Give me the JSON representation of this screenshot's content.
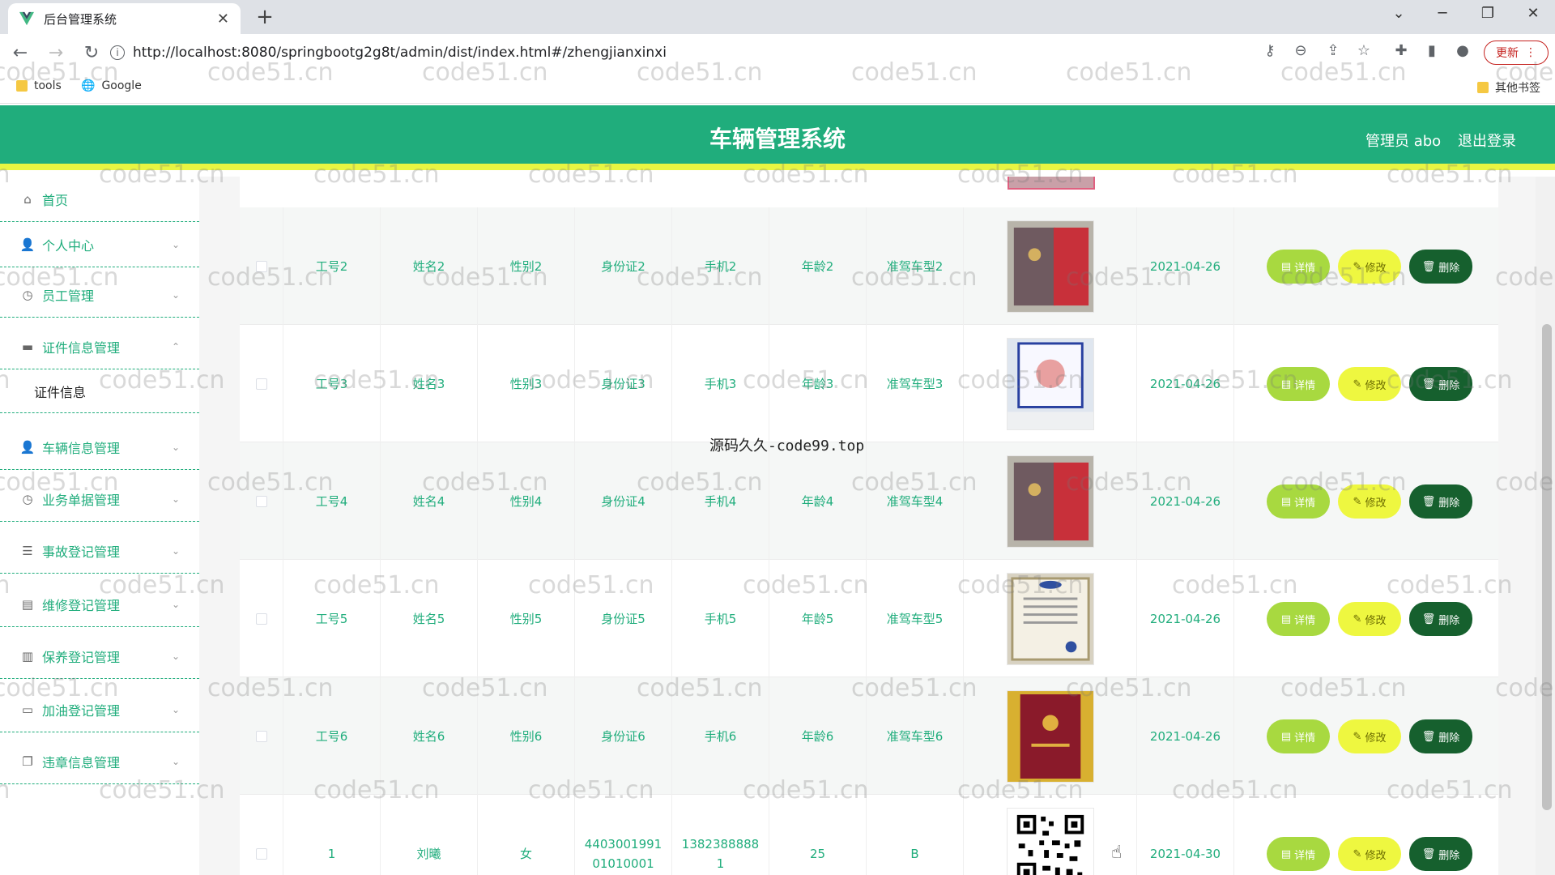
{
  "browser": {
    "tab_title": "后台管理系统",
    "tab_close": "✕",
    "new_tab": "+",
    "url": "http://localhost:8080/springbootg2g8t/admin/dist/index.html#/zhengjianxinxi",
    "update_label": "更新",
    "bookmarks": [
      {
        "label": "tools"
      },
      {
        "label": "Google"
      }
    ],
    "other_bookmarks": "其他书签"
  },
  "app": {
    "title": "车辆管理系统",
    "user": "管理员 abo",
    "logout": "退出登录"
  },
  "sidebar": {
    "items": [
      {
        "label": "首页",
        "icon": "home-icon"
      },
      {
        "label": "个人中心",
        "icon": "user-icon"
      },
      {
        "label": "员工管理",
        "icon": "clock-icon"
      },
      {
        "label": "证件信息管理",
        "icon": "card-icon"
      },
      {
        "label": "车辆信息管理",
        "icon": "user-icon"
      },
      {
        "label": "业务单据管理",
        "icon": "clock-icon"
      },
      {
        "label": "事故登记管理",
        "icon": "sliders-icon"
      },
      {
        "label": "维修登记管理",
        "icon": "printer-icon"
      },
      {
        "label": "保养登记管理",
        "icon": "chart-icon"
      },
      {
        "label": "加油登记管理",
        "icon": "chat-icon"
      },
      {
        "label": "违章信息管理",
        "icon": "copy-icon"
      }
    ],
    "submenu": "证件信息"
  },
  "table": {
    "rows": [
      {
        "no": "工号2",
        "name": "姓名2",
        "gender": "性别2",
        "id": "身份证2",
        "phone": "手机2",
        "age": "年龄2",
        "license": "准驾车型2",
        "img": "book",
        "date": "2021-04-26"
      },
      {
        "no": "工号3",
        "name": "姓名3",
        "gender": "性别3",
        "id": "身份证3",
        "phone": "手机3",
        "age": "年龄3",
        "license": "准驾车型3",
        "img": "cert",
        "date": "2021-04-26"
      },
      {
        "no": "工号4",
        "name": "姓名4",
        "gender": "性别4",
        "id": "身份证4",
        "phone": "手机4",
        "age": "年龄4",
        "license": "准驾车型4",
        "img": "book",
        "date": "2021-04-26"
      },
      {
        "no": "工号5",
        "name": "姓名5",
        "gender": "性别5",
        "id": "身份证5",
        "phone": "手机5",
        "age": "年龄5",
        "license": "准驾车型5",
        "img": "diploma",
        "date": "2021-04-26"
      },
      {
        "no": "工号6",
        "name": "姓名6",
        "gender": "性别6",
        "id": "身份证6",
        "phone": "手机6",
        "age": "年龄6",
        "license": "准驾车型6",
        "img": "redbook",
        "date": "2021-04-26"
      },
      {
        "no": "1",
        "name": "刘曦",
        "gender": "女",
        "id": "440300199101010001",
        "phone": "13823888881",
        "age": "25",
        "license": "B",
        "img": "qr",
        "date": "2021-04-30"
      }
    ],
    "btn_detail": "详情",
    "btn_edit": "修改",
    "btn_delete": "删除"
  },
  "overlay_text": "源码久久-code99.top",
  "watermark_text": "code51.cn",
  "colors": {
    "primary": "#20ad7c",
    "accent_bar": "#e8f542",
    "detail": "#a8d940",
    "edit": "#eef740",
    "delete": "#16602e"
  }
}
